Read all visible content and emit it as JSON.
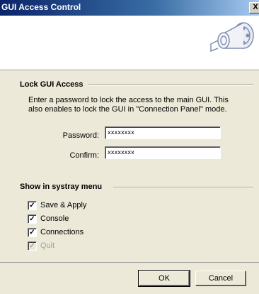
{
  "window": {
    "title": "GUI Access Control",
    "close_label": "X"
  },
  "header": {
    "icon": "plug-connector-icon"
  },
  "lock_section": {
    "title": "Lock GUI Access",
    "description": "Enter a password to lock the access to the main GUI. This also enables to lock the GUI in \"Connection Panel\" mode.",
    "password_label": "Password:",
    "password_value": "xxxxxxxx",
    "confirm_label": "Confirm:",
    "confirm_value": "xxxxxxxx"
  },
  "systray_section": {
    "title": "Show in systray menu",
    "items": [
      {
        "label": "Save & Apply",
        "checked": true,
        "enabled": true
      },
      {
        "label": "Console",
        "checked": true,
        "enabled": true
      },
      {
        "label": "Connections",
        "checked": true,
        "enabled": true
      },
      {
        "label": "Quit",
        "checked": true,
        "enabled": false
      }
    ]
  },
  "buttons": {
    "ok": "OK",
    "cancel": "Cancel"
  },
  "colors": {
    "panel": "#ece9d8",
    "titlebar": "#0a246a"
  }
}
